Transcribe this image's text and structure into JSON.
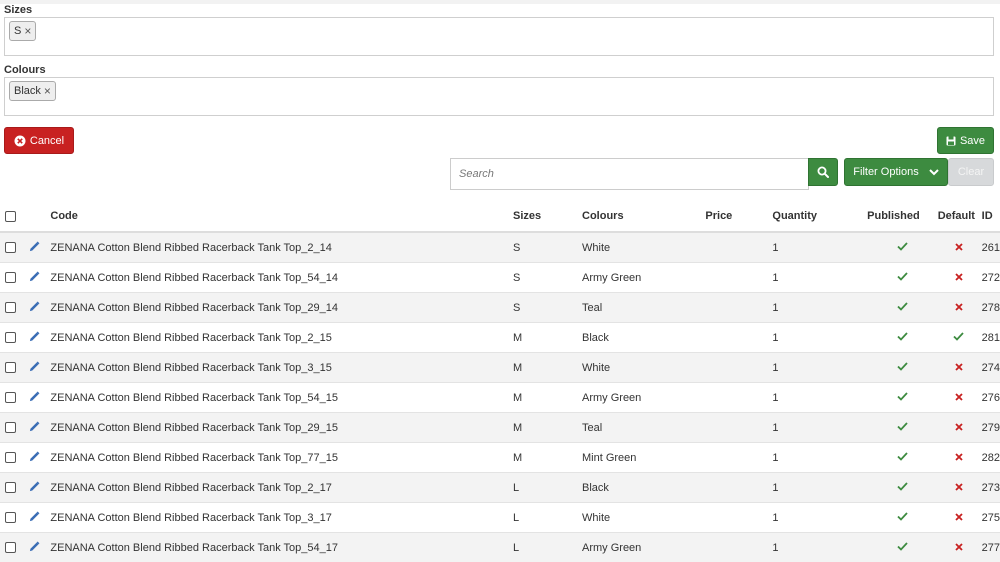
{
  "sizes": {
    "label": "Sizes",
    "tag": "S",
    "tag_remove": "×"
  },
  "colours": {
    "label": "Colours",
    "tag": "Black",
    "tag_remove": "×"
  },
  "buttons": {
    "cancel": "Cancel",
    "save": "Save",
    "filter": "Filter Options",
    "clear": "Clear"
  },
  "search": {
    "placeholder": "Search",
    "value": ""
  },
  "colors": {
    "danger": "#c82121",
    "success": "#3d8b40",
    "link": "#3a6db5"
  },
  "table": {
    "headers": {
      "code": "Code",
      "sizes": "Sizes",
      "colours": "Colours",
      "price": "Price",
      "quantity": "Quantity",
      "published": "Published",
      "default": "Default",
      "id": "ID"
    },
    "rows": [
      {
        "code": "ZENANA Cotton Blend Ribbed Racerback Tank Top_2_14",
        "size": "S",
        "colour": "White",
        "price": "",
        "qty": "1",
        "published": true,
        "default": false,
        "id": "261"
      },
      {
        "code": "ZENANA Cotton Blend Ribbed Racerback Tank Top_54_14",
        "size": "S",
        "colour": "Army Green",
        "price": "",
        "qty": "1",
        "published": true,
        "default": false,
        "id": "272"
      },
      {
        "code": "ZENANA Cotton Blend Ribbed Racerback Tank Top_29_14",
        "size": "S",
        "colour": "Teal",
        "price": "",
        "qty": "1",
        "published": true,
        "default": false,
        "id": "278"
      },
      {
        "code": "ZENANA Cotton Blend Ribbed Racerback Tank Top_2_15",
        "size": "M",
        "colour": "Black",
        "price": "",
        "qty": "1",
        "published": true,
        "default": true,
        "id": "281"
      },
      {
        "code": "ZENANA Cotton Blend Ribbed Racerback Tank Top_3_15",
        "size": "M",
        "colour": "White",
        "price": "",
        "qty": "1",
        "published": true,
        "default": false,
        "id": "274"
      },
      {
        "code": "ZENANA Cotton Blend Ribbed Racerback Tank Top_54_15",
        "size": "M",
        "colour": "Army Green",
        "price": "",
        "qty": "1",
        "published": true,
        "default": false,
        "id": "276"
      },
      {
        "code": "ZENANA Cotton Blend Ribbed Racerback Tank Top_29_15",
        "size": "M",
        "colour": "Teal",
        "price": "",
        "qty": "1",
        "published": true,
        "default": false,
        "id": "279"
      },
      {
        "code": "ZENANA Cotton Blend Ribbed Racerback Tank Top_77_15",
        "size": "M",
        "colour": "Mint Green",
        "price": "",
        "qty": "1",
        "published": true,
        "default": false,
        "id": "282"
      },
      {
        "code": "ZENANA Cotton Blend Ribbed Racerback Tank Top_2_17",
        "size": "L",
        "colour": "Black",
        "price": "",
        "qty": "1",
        "published": true,
        "default": false,
        "id": "273"
      },
      {
        "code": "ZENANA Cotton Blend Ribbed Racerback Tank Top_3_17",
        "size": "L",
        "colour": "White",
        "price": "",
        "qty": "1",
        "published": true,
        "default": false,
        "id": "275"
      },
      {
        "code": "ZENANA Cotton Blend Ribbed Racerback Tank Top_54_17",
        "size": "L",
        "colour": "Army Green",
        "price": "",
        "qty": "1",
        "published": true,
        "default": false,
        "id": "277"
      }
    ]
  }
}
